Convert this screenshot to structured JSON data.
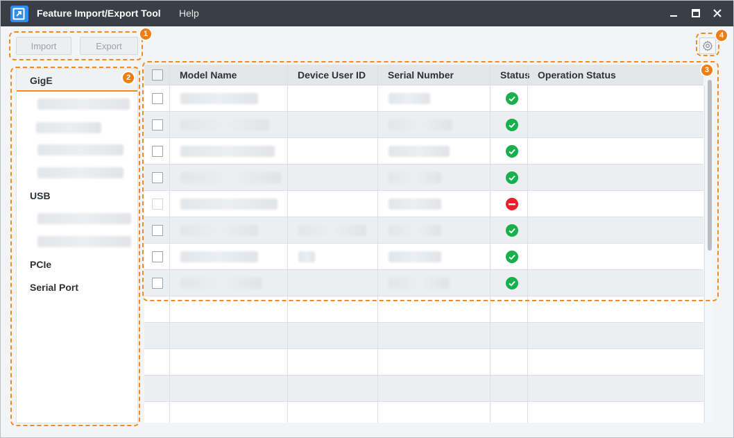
{
  "app": {
    "title": "Feature Import/Export Tool",
    "menu": [
      "Help"
    ],
    "accent_color": "#f08a24",
    "icon": "app-export-icon"
  },
  "window_controls": [
    "minimize-icon",
    "maximize-icon",
    "close-icon"
  ],
  "toolbar": {
    "import_label": "Import",
    "export_label": "Export",
    "settings_icon": "gear-icon"
  },
  "callouts": [
    "1",
    "2",
    "3",
    "4"
  ],
  "sidebar": {
    "categories": [
      {
        "label": "GigE",
        "selected": true,
        "device_count": 4
      },
      {
        "label": "USB",
        "selected": false,
        "device_count": 2
      },
      {
        "label": "PCIe",
        "selected": false,
        "device_count": 0
      },
      {
        "label": "Serial Port",
        "selected": false,
        "device_count": 0
      }
    ]
  },
  "table": {
    "columns": [
      "Model Name",
      "Device User ID",
      "Serial Number",
      "Status",
      "Operation Status"
    ],
    "rows": [
      {
        "status": "ok"
      },
      {
        "status": "ok"
      },
      {
        "status": "ok"
      },
      {
        "status": "ok"
      },
      {
        "status": "error"
      },
      {
        "status": "ok"
      },
      {
        "status": "ok"
      },
      {
        "status": "ok"
      }
    ],
    "status_colors": {
      "ok": "#16b14c",
      "error": "#e6212a"
    }
  }
}
